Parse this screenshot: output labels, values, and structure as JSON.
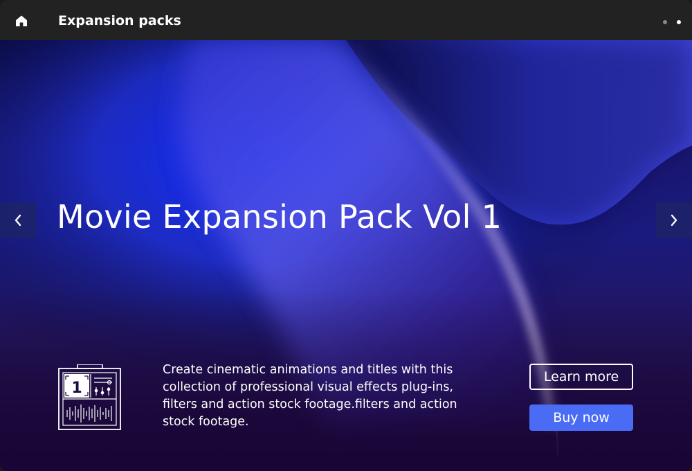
{
  "titlebar": {
    "home_icon": "home-icon",
    "title": "Expansion packs",
    "pagination": {
      "count": 2,
      "active_index": 1
    }
  },
  "hero": {
    "headline": "Movie Expansion Pack Vol 1",
    "description": "Create cinematic animations and titles with this collection of professional visual effects plug-ins, filters and action stock footage.filters and action stock footage.",
    "icon": "expansion-pack-icon",
    "icon_badge": "1",
    "prev_icon": "chevron-left-icon",
    "next_icon": "chevron-right-icon",
    "learn_more_label": "Learn more",
    "buy_now_label": "Buy now"
  },
  "colors": {
    "titlebar_bg": "#222222",
    "accent_button": "#4a6cf5",
    "hero_deep_blue": "#0f2bff",
    "hero_purple": "#1a0636"
  }
}
